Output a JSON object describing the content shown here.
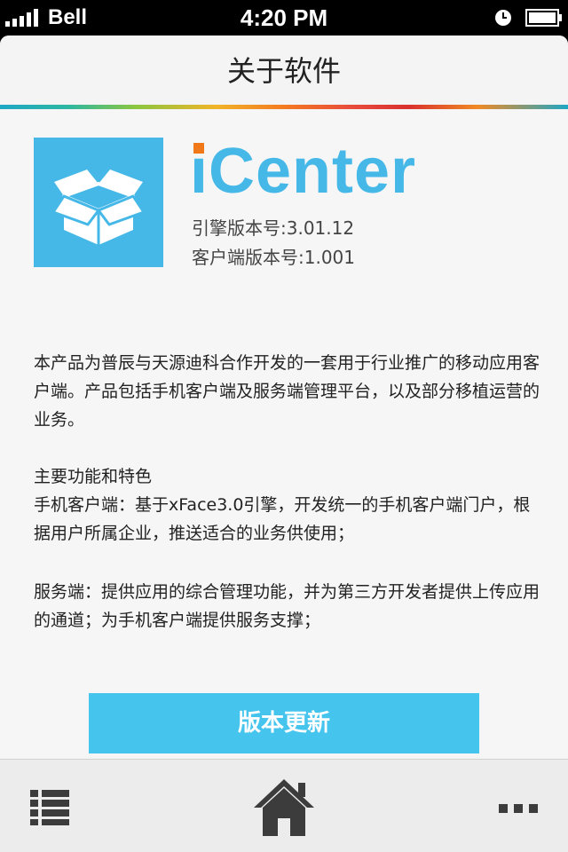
{
  "status_bar": {
    "carrier": "Bell",
    "time": "4:20 PM"
  },
  "navbar": {
    "title": "关于软件"
  },
  "app": {
    "name": "iCenter",
    "engine_version": "引擎版本号:3.01.12",
    "client_version": "客户端版本号:1.001",
    "accent_color": "#45b8e8",
    "dot_color": "#f07818"
  },
  "description": {
    "intro": "本产品为普辰与天源迪科合作开发的一套用于行业推广的移动应用客户端。产品包括手机客户端及服务端管理平台，以及部分移植运营的业务。",
    "features_title": "主要功能和特色",
    "mobile_client": "手机客户端：基于xFace3.0引擎，开发统一的手机客户端门户，根据用户所属企业，推送适合的业务供使用；",
    "server": "服务端：提供应用的综合管理功能，并为第三方开发者提供上传应用的通道；为手机客户端提供服务支撑；"
  },
  "actions": {
    "update_label": "版本更新"
  },
  "tab_bar": {
    "icons": [
      "list-icon",
      "home-icon",
      "more-icon"
    ]
  }
}
